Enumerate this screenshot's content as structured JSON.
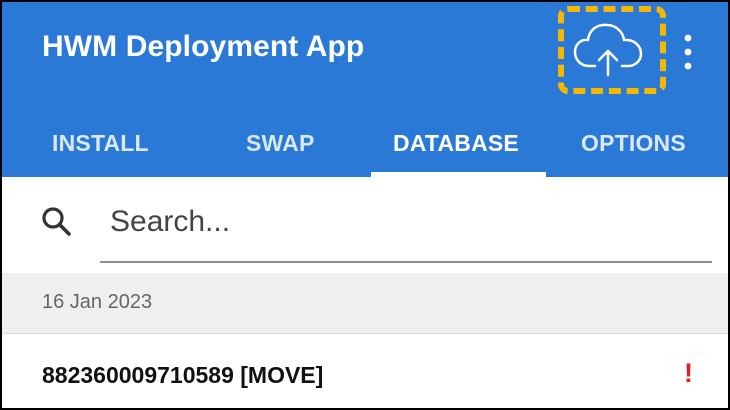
{
  "app": {
    "title": "HWM Deployment App"
  },
  "toolbar": {
    "upload_icon": "cloud-upload-icon",
    "overflow_icon": "more-vert-icon",
    "highlight_color": "#f6b700"
  },
  "tabs": [
    {
      "label": "INSTALL",
      "active": false
    },
    {
      "label": "SWAP",
      "active": false
    },
    {
      "label": "DATABASE",
      "active": true
    },
    {
      "label": "OPTIONS",
      "active": false
    }
  ],
  "search": {
    "placeholder": "Search..."
  },
  "list": {
    "date_header": "16 Jan 2023",
    "items": [
      {
        "label": "882360009710589 [MOVE]",
        "status": "!"
      }
    ]
  },
  "colors": {
    "appbar": "#2a79d6",
    "alert": "#e31f26",
    "date_bg": "#efefef"
  }
}
